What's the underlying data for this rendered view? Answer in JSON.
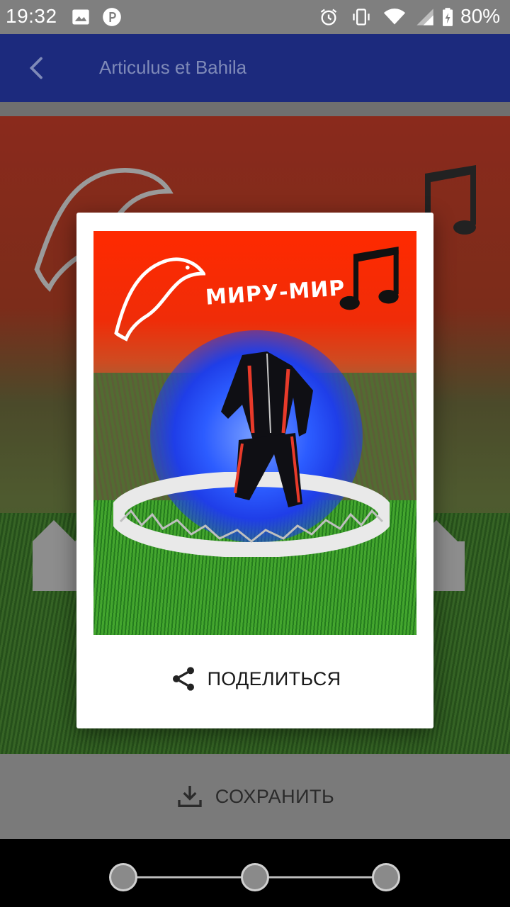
{
  "status_bar": {
    "time": "19:32",
    "battery": "80%",
    "icons": [
      "image-icon",
      "parking-icon",
      "alarm-icon",
      "vibrate-icon",
      "wifi-icon",
      "signal-icon",
      "battery-icon"
    ]
  },
  "app_bar": {
    "title": "Articulus et Bahila",
    "back_icon": "back-arrow-icon"
  },
  "dialog": {
    "image_caption": "МИРУ-МИР",
    "share_label": "ПОДЕЛИТЬСЯ",
    "share_icon": "share-icon"
  },
  "bottom_bar": {
    "save_label": "СОХРАНИТЬ",
    "save_icon": "download-icon"
  },
  "nav_bar": {
    "icons": [
      "nav-left-icon",
      "nav-home-icon",
      "nav-right-icon"
    ]
  },
  "colors": {
    "app_bar": "#1c2a7d",
    "status_bar": "#7f7f7f",
    "image_red": "#ff2a00",
    "image_blue": "#2c5cff"
  }
}
